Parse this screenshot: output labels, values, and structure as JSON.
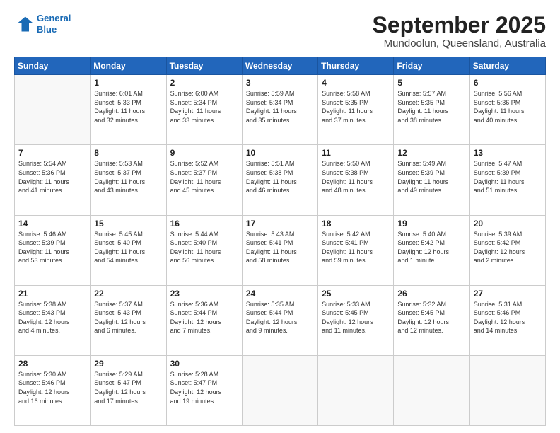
{
  "logo": {
    "line1": "General",
    "line2": "Blue"
  },
  "title": "September 2025",
  "location": "Mundoolun, Queensland, Australia",
  "days_header": [
    "Sunday",
    "Monday",
    "Tuesday",
    "Wednesday",
    "Thursday",
    "Friday",
    "Saturday"
  ],
  "weeks": [
    [
      {
        "num": "",
        "info": ""
      },
      {
        "num": "1",
        "info": "Sunrise: 6:01 AM\nSunset: 5:33 PM\nDaylight: 11 hours\nand 32 minutes."
      },
      {
        "num": "2",
        "info": "Sunrise: 6:00 AM\nSunset: 5:34 PM\nDaylight: 11 hours\nand 33 minutes."
      },
      {
        "num": "3",
        "info": "Sunrise: 5:59 AM\nSunset: 5:34 PM\nDaylight: 11 hours\nand 35 minutes."
      },
      {
        "num": "4",
        "info": "Sunrise: 5:58 AM\nSunset: 5:35 PM\nDaylight: 11 hours\nand 37 minutes."
      },
      {
        "num": "5",
        "info": "Sunrise: 5:57 AM\nSunset: 5:35 PM\nDaylight: 11 hours\nand 38 minutes."
      },
      {
        "num": "6",
        "info": "Sunrise: 5:56 AM\nSunset: 5:36 PM\nDaylight: 11 hours\nand 40 minutes."
      }
    ],
    [
      {
        "num": "7",
        "info": "Sunrise: 5:54 AM\nSunset: 5:36 PM\nDaylight: 11 hours\nand 41 minutes."
      },
      {
        "num": "8",
        "info": "Sunrise: 5:53 AM\nSunset: 5:37 PM\nDaylight: 11 hours\nand 43 minutes."
      },
      {
        "num": "9",
        "info": "Sunrise: 5:52 AM\nSunset: 5:37 PM\nDaylight: 11 hours\nand 45 minutes."
      },
      {
        "num": "10",
        "info": "Sunrise: 5:51 AM\nSunset: 5:38 PM\nDaylight: 11 hours\nand 46 minutes."
      },
      {
        "num": "11",
        "info": "Sunrise: 5:50 AM\nSunset: 5:38 PM\nDaylight: 11 hours\nand 48 minutes."
      },
      {
        "num": "12",
        "info": "Sunrise: 5:49 AM\nSunset: 5:39 PM\nDaylight: 11 hours\nand 49 minutes."
      },
      {
        "num": "13",
        "info": "Sunrise: 5:47 AM\nSunset: 5:39 PM\nDaylight: 11 hours\nand 51 minutes."
      }
    ],
    [
      {
        "num": "14",
        "info": "Sunrise: 5:46 AM\nSunset: 5:39 PM\nDaylight: 11 hours\nand 53 minutes."
      },
      {
        "num": "15",
        "info": "Sunrise: 5:45 AM\nSunset: 5:40 PM\nDaylight: 11 hours\nand 54 minutes."
      },
      {
        "num": "16",
        "info": "Sunrise: 5:44 AM\nSunset: 5:40 PM\nDaylight: 11 hours\nand 56 minutes."
      },
      {
        "num": "17",
        "info": "Sunrise: 5:43 AM\nSunset: 5:41 PM\nDaylight: 11 hours\nand 58 minutes."
      },
      {
        "num": "18",
        "info": "Sunrise: 5:42 AM\nSunset: 5:41 PM\nDaylight: 11 hours\nand 59 minutes."
      },
      {
        "num": "19",
        "info": "Sunrise: 5:40 AM\nSunset: 5:42 PM\nDaylight: 12 hours\nand 1 minute."
      },
      {
        "num": "20",
        "info": "Sunrise: 5:39 AM\nSunset: 5:42 PM\nDaylight: 12 hours\nand 2 minutes."
      }
    ],
    [
      {
        "num": "21",
        "info": "Sunrise: 5:38 AM\nSunset: 5:43 PM\nDaylight: 12 hours\nand 4 minutes."
      },
      {
        "num": "22",
        "info": "Sunrise: 5:37 AM\nSunset: 5:43 PM\nDaylight: 12 hours\nand 6 minutes."
      },
      {
        "num": "23",
        "info": "Sunrise: 5:36 AM\nSunset: 5:44 PM\nDaylight: 12 hours\nand 7 minutes."
      },
      {
        "num": "24",
        "info": "Sunrise: 5:35 AM\nSunset: 5:44 PM\nDaylight: 12 hours\nand 9 minutes."
      },
      {
        "num": "25",
        "info": "Sunrise: 5:33 AM\nSunset: 5:45 PM\nDaylight: 12 hours\nand 11 minutes."
      },
      {
        "num": "26",
        "info": "Sunrise: 5:32 AM\nSunset: 5:45 PM\nDaylight: 12 hours\nand 12 minutes."
      },
      {
        "num": "27",
        "info": "Sunrise: 5:31 AM\nSunset: 5:46 PM\nDaylight: 12 hours\nand 14 minutes."
      }
    ],
    [
      {
        "num": "28",
        "info": "Sunrise: 5:30 AM\nSunset: 5:46 PM\nDaylight: 12 hours\nand 16 minutes."
      },
      {
        "num": "29",
        "info": "Sunrise: 5:29 AM\nSunset: 5:47 PM\nDaylight: 12 hours\nand 17 minutes."
      },
      {
        "num": "30",
        "info": "Sunrise: 5:28 AM\nSunset: 5:47 PM\nDaylight: 12 hours\nand 19 minutes."
      },
      {
        "num": "",
        "info": ""
      },
      {
        "num": "",
        "info": ""
      },
      {
        "num": "",
        "info": ""
      },
      {
        "num": "",
        "info": ""
      }
    ]
  ]
}
